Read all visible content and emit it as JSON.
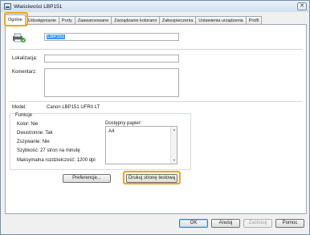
{
  "window": {
    "title": "Właściwości LBP151"
  },
  "tabs": [
    "Ogólne",
    "Udostępnianie",
    "Porty",
    "Zaawansowane",
    "Zarządzanie kolorami",
    "Zabezpieczenia",
    "Ustawienia urządzenia",
    "Profil"
  ],
  "general": {
    "printer_name": "LBP151",
    "location_label": "Lokalizacja:",
    "location_value": "",
    "comment_label": "Komentarz:",
    "comment_value": "",
    "model_label": "Model:",
    "model_value": "Canon LBP151 UFRII LT",
    "features_title": "Funkcje",
    "color": "Kolor: Nie",
    "duplex": "Dwustronne: Tak",
    "staple": "Zszywanie: Nie",
    "speed": "Szybkość: 27 stron na minutę",
    "resolution": "Maksymalna rozdzielczość: 1200  dpi",
    "paper_label": "Dostępny papier:",
    "paper_items": [
      "A4"
    ]
  },
  "buttons": {
    "preferences": "Preferencje...",
    "print_test": "Drukuj stronę testową",
    "ok": "OK",
    "cancel": "Anuluj",
    "apply": "Zastosuj",
    "help": "Pomoc"
  },
  "colors": {
    "highlight": "#f5a11f",
    "selection": "#3399ff"
  }
}
